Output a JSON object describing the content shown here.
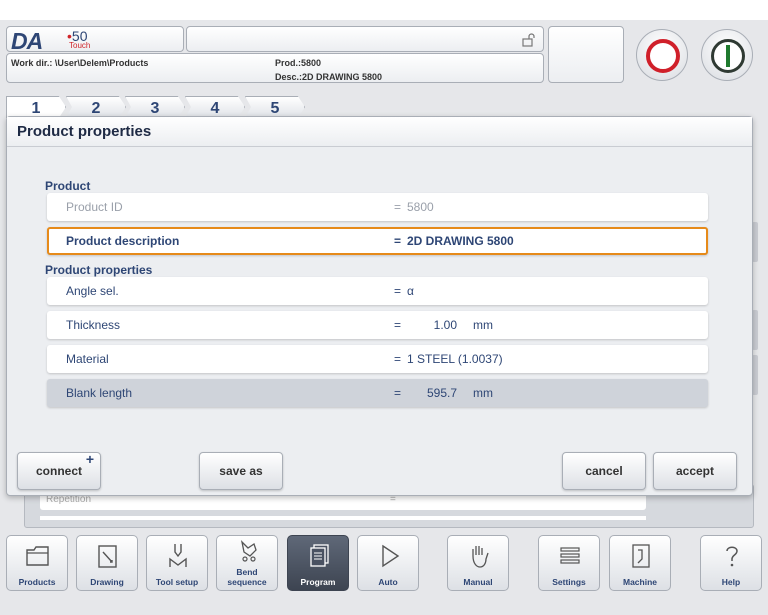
{
  "header": {
    "logo_da": "DA",
    "logo_50": "50",
    "logo_touch": "Touch",
    "work_dir": "Work dir.: \\User\\Delem\\Products",
    "prod": "Prod.:5800",
    "desc": "Desc.:2D DRAWING 5800"
  },
  "tabs": [
    "1",
    "2",
    "3",
    "4",
    "5"
  ],
  "dialog": {
    "title": "Product properties",
    "section_product": "Product",
    "section_properties": "Product properties",
    "rows": [
      {
        "label": "Product ID",
        "eq": "=",
        "value": "5800",
        "unit": ""
      },
      {
        "label": "Product description",
        "eq": "=",
        "value": "2D DRAWING 5800",
        "unit": ""
      },
      {
        "label": "Angle sel.",
        "eq": "=",
        "value": "α",
        "unit": ""
      },
      {
        "label": "Thickness",
        "eq": "=",
        "value": "1.00",
        "unit": "mm"
      },
      {
        "label": "Material",
        "eq": "=",
        "value": "1 STEEL (1.0037)",
        "unit": ""
      },
      {
        "label": "Blank length",
        "eq": "=",
        "value": "595.7",
        "unit": "mm"
      }
    ],
    "buttons": {
      "connect": "connect",
      "connect_plus": "+",
      "save_as": "save as",
      "cancel": "cancel",
      "accept": "accept"
    }
  },
  "background": {
    "row_label": "Repetition",
    "row_eq": "="
  },
  "nav": [
    {
      "label": "Products",
      "icon": "folder-icon"
    },
    {
      "label": "Drawing",
      "icon": "drawing-icon"
    },
    {
      "label": "Tool setup",
      "icon": "tool-setup-icon"
    },
    {
      "label": "Bend sequence",
      "icon": "bend-sequence-icon"
    },
    {
      "label": "Program",
      "icon": "program-icon"
    },
    {
      "label": "Auto",
      "icon": "play-icon"
    },
    {
      "label": "Manual",
      "icon": "hand-icon"
    },
    {
      "label": "Settings",
      "icon": "settings-icon"
    },
    {
      "label": "Machine",
      "icon": "machine-icon"
    },
    {
      "label": "Help",
      "icon": "help-icon"
    }
  ],
  "colors": {
    "accent": "#2e4675",
    "selection_border": "#e68a1a",
    "stop": "#d0202a",
    "start": "#1f7a2e"
  }
}
